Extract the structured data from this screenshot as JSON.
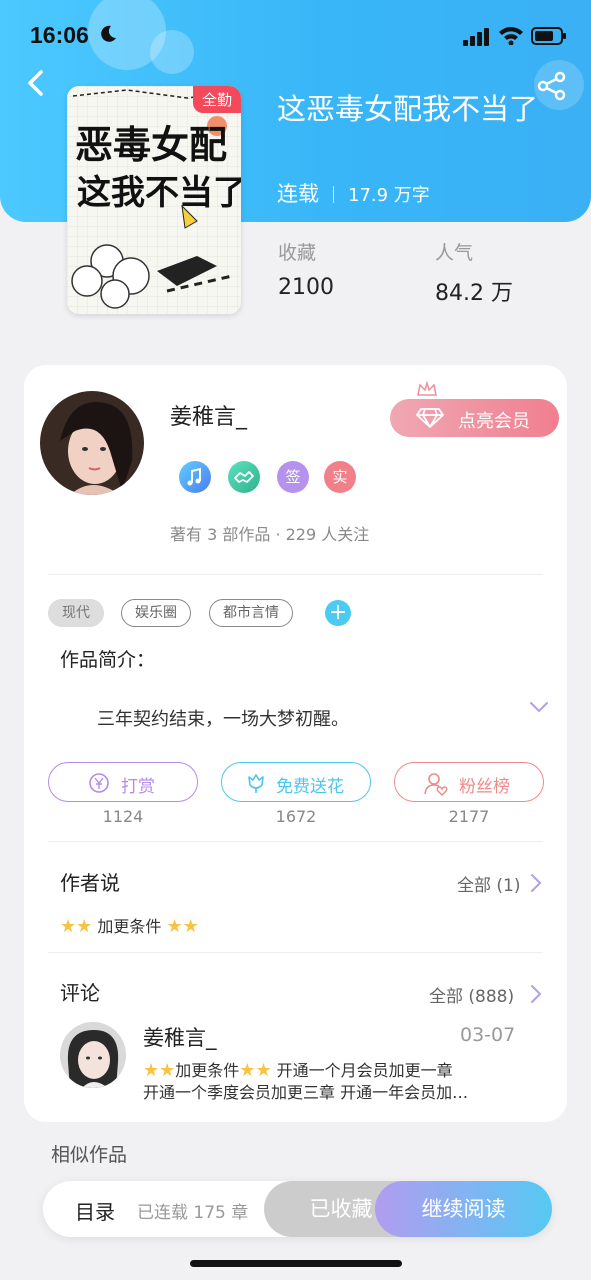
{
  "status_bar": {
    "time": "16:06"
  },
  "book": {
    "cover_badge": "全勤",
    "cover_title_lines": [
      "恶毒女配",
      "这我不当了"
    ],
    "title": "这恶毒女配我不当了",
    "status": "连载",
    "word_count": "17.9 万字",
    "stats": [
      {
        "label": "收藏",
        "value": "2100"
      },
      {
        "label": "人气",
        "value": "84.2 万"
      }
    ]
  },
  "author": {
    "name": "姜稚言_",
    "vip_button": "点亮会员",
    "badges": [
      {
        "icon": "music-note-icon",
        "color": "#49a7f5"
      },
      {
        "icon": "handshake-icon",
        "color": "#3cc7a8"
      },
      {
        "text": "签",
        "color": "#b28cf0"
      },
      {
        "text": "实",
        "color": "#f47c86"
      }
    ],
    "works_info": "著有 3 部作品 · 229 人关注"
  },
  "tags": [
    "现代",
    "娱乐圈",
    "都市言情"
  ],
  "intro": {
    "title": "作品简介：",
    "text": "三年契约结束，一场大梦初醒。"
  },
  "actions": [
    {
      "label": "打赏",
      "count": "1124",
      "color": "#b48bea"
    },
    {
      "label": "免费送花",
      "count": "1672",
      "color": "#4cc6ee"
    },
    {
      "label": "粉丝榜",
      "count": "2177",
      "color": "#ef8a8a"
    }
  ],
  "author_says": {
    "title": "作者说",
    "link": "全部 (1)",
    "note": "加更条件"
  },
  "comments": {
    "title": "评论",
    "link": "全部 (888)",
    "item": {
      "name": "姜稚言_",
      "date": "03-07",
      "line1": "加更条件",
      "line1_rest": "开通一个月会员加更一章",
      "line2": "开通一个季度会员加更三章  开通一年会员加…"
    }
  },
  "similar_title": "相似作品",
  "bottom_bar": {
    "toc": "目录",
    "chapters": "已连载 175 章",
    "favorited": "已收藏",
    "continue": "继续阅读"
  }
}
